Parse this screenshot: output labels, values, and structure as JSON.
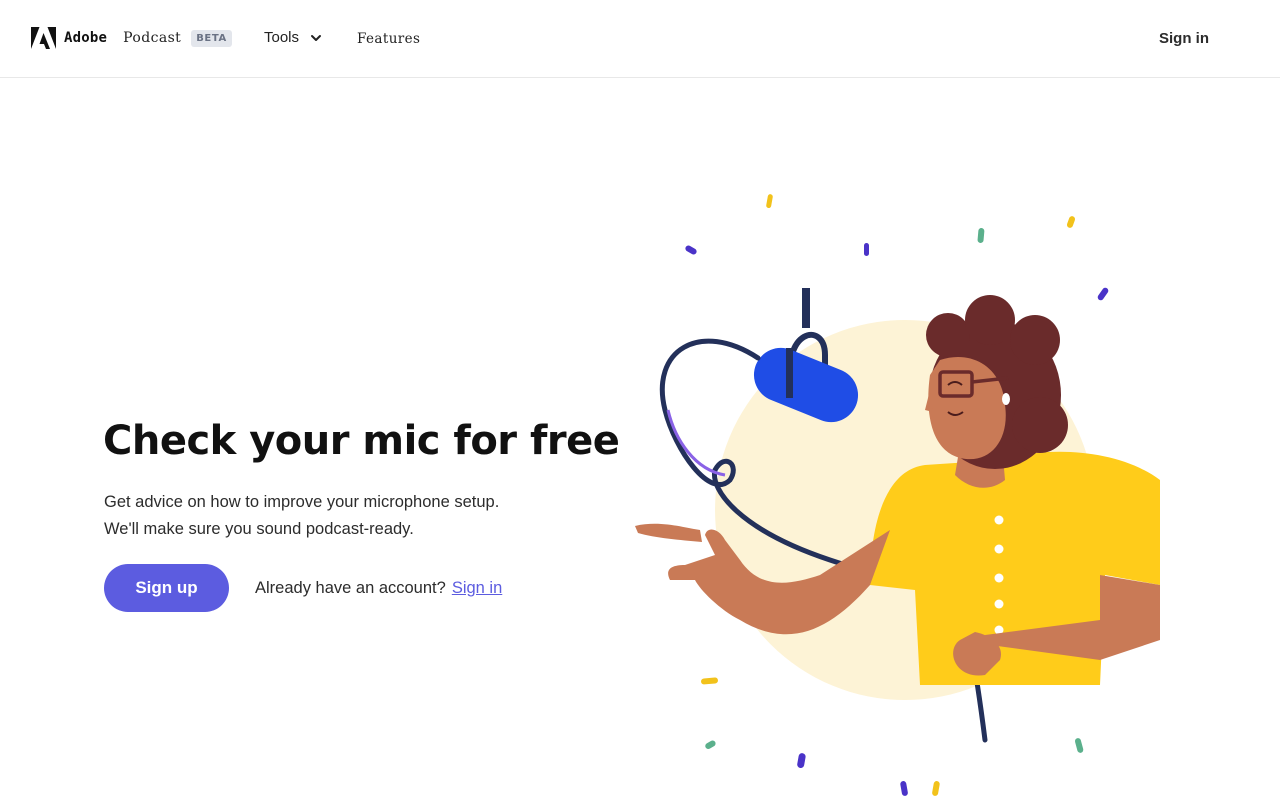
{
  "header": {
    "brand": "Adobe",
    "product": "Podcast",
    "badge": "BETA",
    "nav": {
      "tools_label": "Tools",
      "features_label": "Features"
    },
    "signin_label": "Sign in"
  },
  "hero": {
    "title": "Check your mic for free",
    "description_lines": [
      "Get advice on how to improve your microphone setup.",
      "We'll make sure you sound podcast-ready."
    ],
    "signup_label": "Sign up",
    "account_prompt": "Already have an account?",
    "account_signin_label": "Sign in"
  },
  "colors": {
    "accent": "#5c5ce0",
    "shirt": "#ffcc1a",
    "skin": "#c97a56",
    "hair": "#6a2b2b",
    "mic": "#1f4de6",
    "backdrop": "#fdf3d6"
  },
  "icons": {
    "logo": "adobe-logo-icon",
    "tools_chevron": "chevron-down-icon"
  }
}
